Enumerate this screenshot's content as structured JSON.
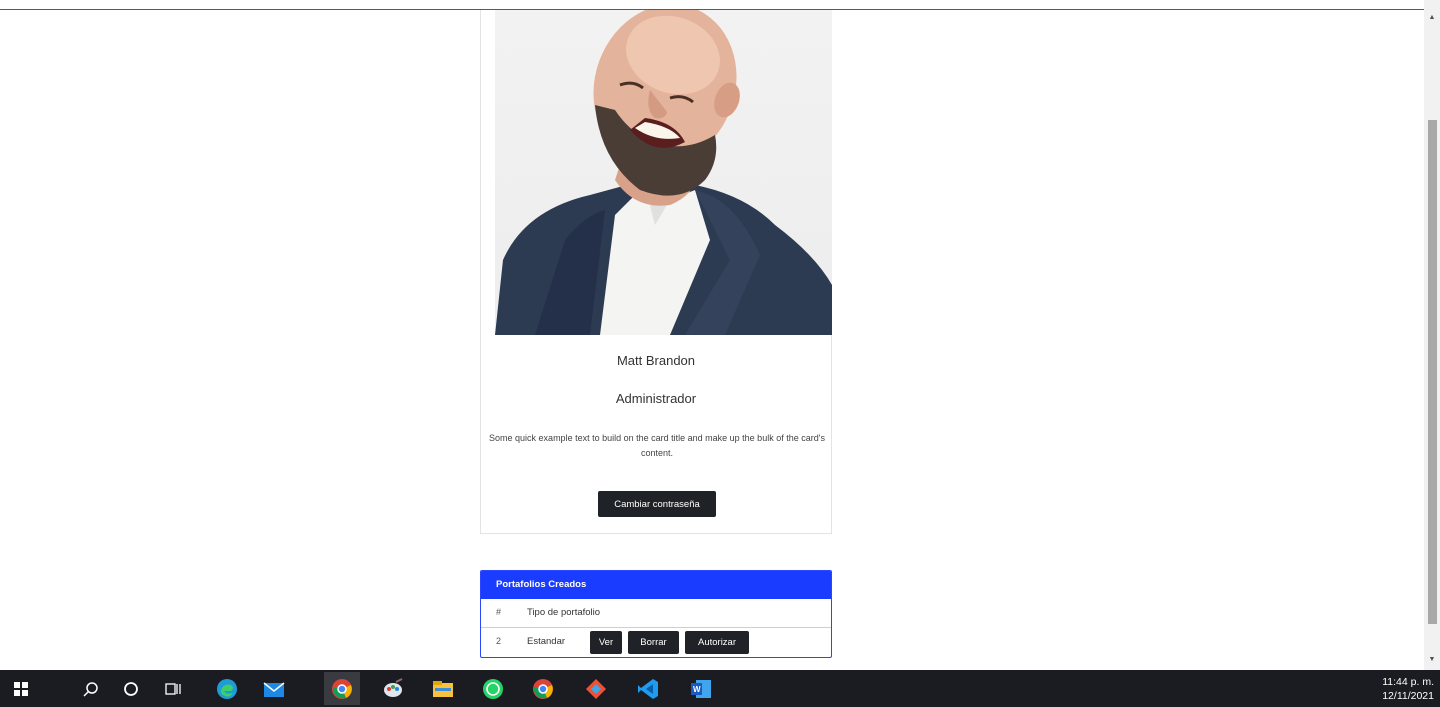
{
  "profile": {
    "name": "Matt Brandon",
    "role": "Administrador",
    "description": "Some quick example text to build on the card title and make up the bulk of the card's content.",
    "change_password_label": "Cambiar contraseña"
  },
  "portfolios": {
    "title": "Portafolios Creados",
    "columns": [
      "#",
      "Tipo de portafolio"
    ],
    "rows": [
      {
        "num": "2",
        "type": "Estandar",
        "actions": [
          "Ver",
          "Borrar",
          "Autorizar"
        ]
      }
    ]
  },
  "taskbar": {
    "icons": [
      "windows-start-icon",
      "search-icon",
      "cortana-icon",
      "task-view-icon",
      "edge-icon",
      "mail-icon",
      "chrome-profile-icon",
      "paint-icon",
      "file-explorer-icon",
      "whatsapp-icon",
      "chrome-icon",
      "git-icon",
      "vscode-icon",
      "word-icon"
    ],
    "time": "11:44 p. m.",
    "date": "12/11/2021"
  }
}
